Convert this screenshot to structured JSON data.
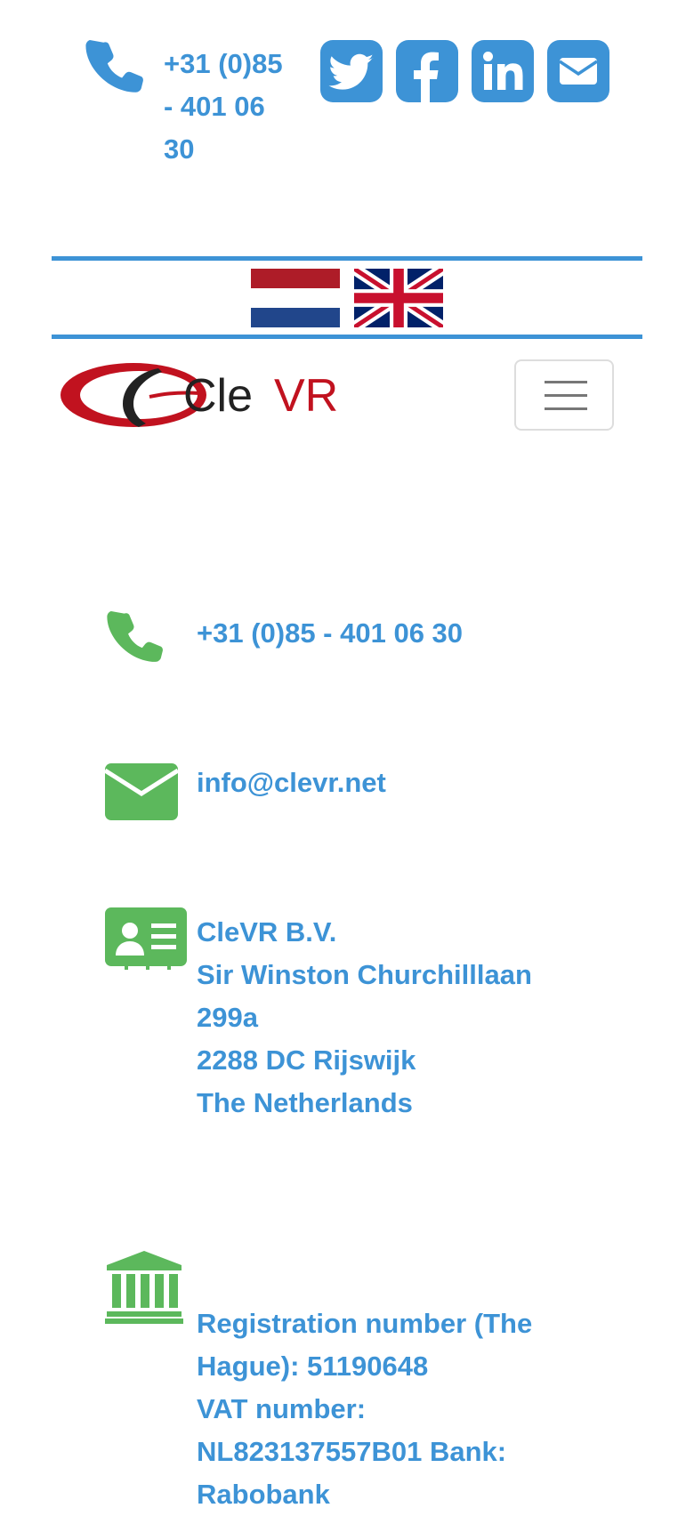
{
  "header": {
    "phone_icon": "phone-icon",
    "phone_text": "+31 (0)85 - 401 06 30",
    "social": [
      {
        "name": "twitter",
        "icon": "twitter-icon"
      },
      {
        "name": "facebook",
        "icon": "facebook-icon"
      },
      {
        "name": "linkedin",
        "icon": "linkedin-icon"
      },
      {
        "name": "email",
        "icon": "envelope-icon"
      }
    ]
  },
  "languages": [
    {
      "code": "nl",
      "icon": "dutch-flag-icon"
    },
    {
      "code": "en",
      "icon": "uk-flag-icon"
    }
  ],
  "brand": {
    "logo_text_dark": "Cle",
    "logo_text_red": "VR",
    "menu_icon": "hamburger-icon"
  },
  "contact": {
    "phone": "+31 (0)85 - 401 06 30",
    "email": "info@clevr.net",
    "address": {
      "company": "CleVR B.V.",
      "street": "Sir Winston Churchilllaan 299a",
      "city": "2288 DC Rijswijk",
      "country": "The Netherlands"
    },
    "registration_lines": [
      "Registration number (The Hague): 51190648",
      "VAT number: NL823137557B01 Bank: Rabobank"
    ]
  },
  "colors": {
    "link_blue": "#3d93d6",
    "icon_green": "#5cb85c",
    "logo_red": "#c1121f"
  }
}
